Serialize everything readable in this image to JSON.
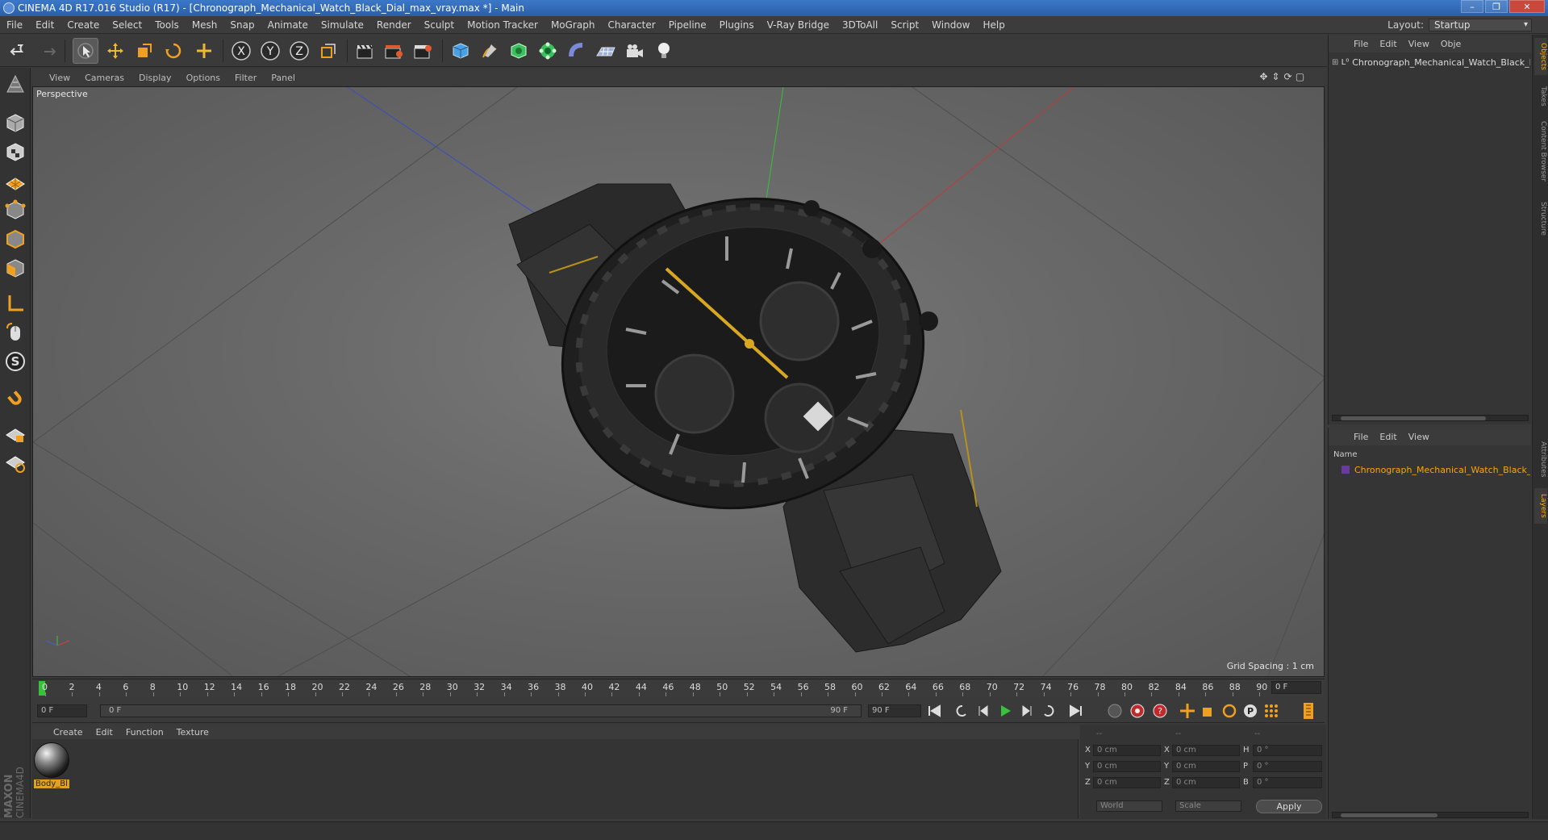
{
  "window": {
    "title": "CINEMA 4D R17.016 Studio (R17) - [Chronograph_Mechanical_Watch_Black_Dial_max_vray.max *] - Main",
    "min": "–",
    "max": "❐",
    "close": "✕"
  },
  "menubar": [
    "File",
    "Edit",
    "Create",
    "Select",
    "Tools",
    "Mesh",
    "Snap",
    "Animate",
    "Simulate",
    "Render",
    "Sculpt",
    "Motion Tracker",
    "MoGraph",
    "Character",
    "Pipeline",
    "Plugins",
    "V-Ray Bridge",
    "3DToAll",
    "Script",
    "Window",
    "Help"
  ],
  "layout": {
    "label": "Layout:",
    "value": "Startup"
  },
  "viewport": {
    "menu": [
      "View",
      "Cameras",
      "Display",
      "Options",
      "Filter",
      "Panel"
    ],
    "label": "Perspective",
    "grid_spacing": "Grid Spacing : 1 cm"
  },
  "timeline": {
    "ticks": [
      "0",
      "2",
      "4",
      "6",
      "8",
      "10",
      "12",
      "14",
      "16",
      "18",
      "20",
      "22",
      "24",
      "26",
      "28",
      "30",
      "32",
      "34",
      "36",
      "38",
      "40",
      "42",
      "44",
      "46",
      "48",
      "50",
      "52",
      "54",
      "56",
      "58",
      "60",
      "62",
      "64",
      "66",
      "68",
      "70",
      "72",
      "74",
      "76",
      "78",
      "80",
      "82",
      "84",
      "86",
      "88",
      "90"
    ],
    "end_frame": "0 F"
  },
  "transport": {
    "current_frame": "0 F",
    "range_start": "0 F",
    "range_end": "90 F",
    "max_frame": "90 F"
  },
  "material_manager": {
    "menu": [
      "Create",
      "Edit",
      "Function",
      "Texture"
    ],
    "material_name": "Body_Bl"
  },
  "coordinates": {
    "headers": [
      "--",
      "--",
      "--"
    ],
    "rows": [
      {
        "a": "X",
        "av": "0 cm",
        "b": "X",
        "bv": "0 cm",
        "c": "H",
        "cv": "0 °"
      },
      {
        "a": "Y",
        "av": "0 cm",
        "b": "Y",
        "bv": "0 cm",
        "c": "P",
        "cv": "0 °"
      },
      {
        "a": "Z",
        "av": "0 cm",
        "b": "Z",
        "bv": "0 cm",
        "c": "B",
        "cv": "0 °"
      }
    ],
    "world": "World",
    "scale": "Scale",
    "apply": "Apply"
  },
  "object_manager": {
    "menu": [
      "File",
      "Edit",
      "View",
      "Obje"
    ],
    "object_name": "Chronograph_Mechanical_Watch_Black_D"
  },
  "layers_manager": {
    "menu": [
      "File",
      "Edit",
      "View"
    ],
    "column": "Name",
    "layer_name": "Chronograph_Mechanical_Watch_Black_"
  },
  "right_tabs": [
    "Objects",
    "Takes",
    "Content Browser",
    "Structure",
    "Attributes",
    "Layers"
  ],
  "brand": {
    "line1": "MAXON",
    "line2": "CINEMA4D"
  },
  "colors": {
    "accent": "#ffb000",
    "title_bar": "#2f68b8",
    "layer_text": "#ffa500",
    "play": "#39c23b"
  }
}
